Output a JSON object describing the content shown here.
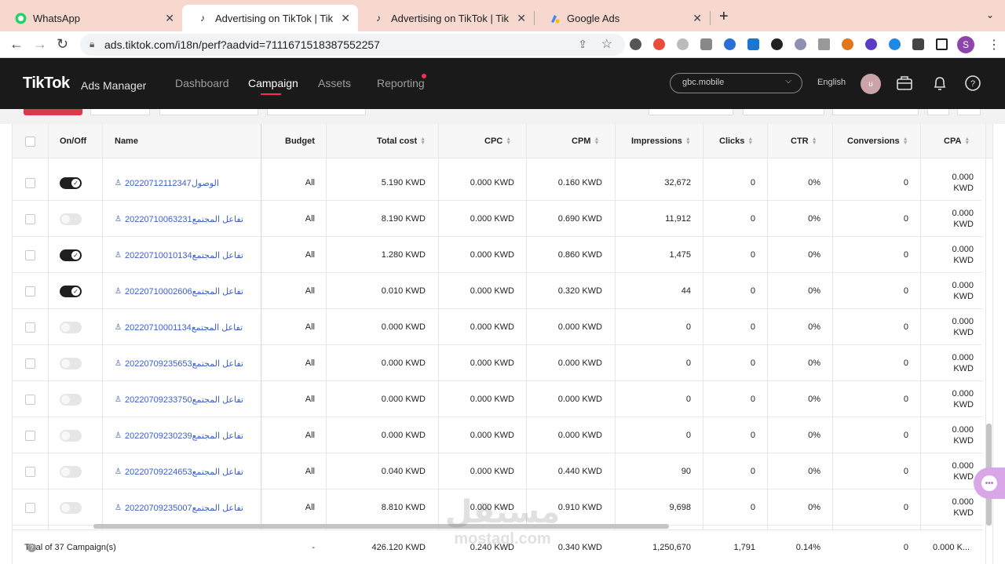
{
  "browser": {
    "tabs": [
      {
        "title": "WhatsApp",
        "icon": "whatsapp-icon",
        "active": false
      },
      {
        "title": "Advertising on TikTok | TikTok Ads",
        "icon": "tiktok-icon",
        "active": true
      },
      {
        "title": "Advertising on TikTok | TikTok Ads",
        "icon": "tiktok-icon",
        "active": false
      },
      {
        "title": "Google Ads",
        "icon": "google-ads-icon",
        "active": false
      }
    ],
    "url": "ads.tiktok.com/i18n/perf?aadvid=7111671518387552257",
    "profile_initial": "S"
  },
  "app": {
    "logo": "TikTok",
    "logo_sub": "Ads Manager",
    "nav": [
      "Dashboard",
      "Campaign",
      "Assets",
      "Reporting"
    ],
    "active_nav": "Campaign",
    "account": "gbc.mobile",
    "language": "English",
    "avatar_initial": "u",
    "accent_color": "#fe2c55"
  },
  "table": {
    "headers": {
      "onoff": "On/Off",
      "name": "Name",
      "budget": "Budget",
      "total_cost": "Total cost",
      "cpc": "CPC",
      "cpm": "CPM",
      "impressions": "Impressions",
      "clicks": "Clicks",
      "ctr": "CTR",
      "conversions": "Conversions",
      "cpa": "CPA"
    },
    "rows": [
      {
        "on": true,
        "name": "الوصول20220712112347",
        "budget": "All",
        "total_cost": "5.190 KWD",
        "cpc": "0.000 KWD",
        "cpm": "0.160 KWD",
        "impressions": "32,672",
        "clicks": "0",
        "ctr": "0%",
        "conversions": "0",
        "cpa1": "0.000",
        "cpa2": "KWD"
      },
      {
        "on": false,
        "name": "تفاعل المجتمع20220710063231",
        "budget": "All",
        "total_cost": "8.190 KWD",
        "cpc": "0.000 KWD",
        "cpm": "0.690 KWD",
        "impressions": "11,912",
        "clicks": "0",
        "ctr": "0%",
        "conversions": "0",
        "cpa1": "0.000",
        "cpa2": "KWD"
      },
      {
        "on": true,
        "name": "تفاعل المجتمع20220710010134",
        "budget": "All",
        "total_cost": "1.280 KWD",
        "cpc": "0.000 KWD",
        "cpm": "0.860 KWD",
        "impressions": "1,475",
        "clicks": "0",
        "ctr": "0%",
        "conversions": "0",
        "cpa1": "0.000",
        "cpa2": "KWD"
      },
      {
        "on": true,
        "name": "تفاعل المجتمع20220710002606",
        "budget": "All",
        "total_cost": "0.010 KWD",
        "cpc": "0.000 KWD",
        "cpm": "0.320 KWD",
        "impressions": "44",
        "clicks": "0",
        "ctr": "0%",
        "conversions": "0",
        "cpa1": "0.000",
        "cpa2": "KWD"
      },
      {
        "on": false,
        "name": "تفاعل المجتمع20220710001134",
        "budget": "All",
        "total_cost": "0.000 KWD",
        "cpc": "0.000 KWD",
        "cpm": "0.000 KWD",
        "impressions": "0",
        "clicks": "0",
        "ctr": "0%",
        "conversions": "0",
        "cpa1": "0.000",
        "cpa2": "KWD"
      },
      {
        "on": false,
        "name": "تفاعل المجتمع20220709235653",
        "budget": "All",
        "total_cost": "0.000 KWD",
        "cpc": "0.000 KWD",
        "cpm": "0.000 KWD",
        "impressions": "0",
        "clicks": "0",
        "ctr": "0%",
        "conversions": "0",
        "cpa1": "0.000",
        "cpa2": "KWD"
      },
      {
        "on": false,
        "name": "تفاعل المجتمع20220709233750",
        "budget": "All",
        "total_cost": "0.000 KWD",
        "cpc": "0.000 KWD",
        "cpm": "0.000 KWD",
        "impressions": "0",
        "clicks": "0",
        "ctr": "0%",
        "conversions": "0",
        "cpa1": "0.000",
        "cpa2": "KWD"
      },
      {
        "on": false,
        "name": "تفاعل المجتمع20220709230239",
        "budget": "All",
        "total_cost": "0.000 KWD",
        "cpc": "0.000 KWD",
        "cpm": "0.000 KWD",
        "impressions": "0",
        "clicks": "0",
        "ctr": "0%",
        "conversions": "0",
        "cpa1": "0.000",
        "cpa2": "KWD"
      },
      {
        "on": false,
        "name": "تفاعل المجتمع20220709224653",
        "budget": "All",
        "total_cost": "0.040 KWD",
        "cpc": "0.000 KWD",
        "cpm": "0.440 KWD",
        "impressions": "90",
        "clicks": "0",
        "ctr": "0%",
        "conversions": "0",
        "cpa1": "0.000",
        "cpa2": "KWD"
      },
      {
        "on": false,
        "name": "تفاعل المجتمع20220709235007",
        "budget": "All",
        "total_cost": "8.810 KWD",
        "cpc": "0.000 KWD",
        "cpm": "0.910 KWD",
        "impressions": "9,698",
        "clicks": "0",
        "ctr": "0%",
        "conversions": "0",
        "cpa1": "0.000",
        "cpa2": "KWD"
      }
    ],
    "footer": {
      "label": "Total of 37 Campaign(s)",
      "budget": "-",
      "total_cost": "426.120 KWD",
      "cpc": "0.240 KWD",
      "cpm": "0.340 KWD",
      "impressions": "1,250,670",
      "clicks": "1,791",
      "ctr": "0.14%",
      "conversions": "0",
      "cpa": "0.000 K..."
    }
  },
  "watermark": {
    "line1": "مستقل",
    "line2": "mostaql.com"
  }
}
